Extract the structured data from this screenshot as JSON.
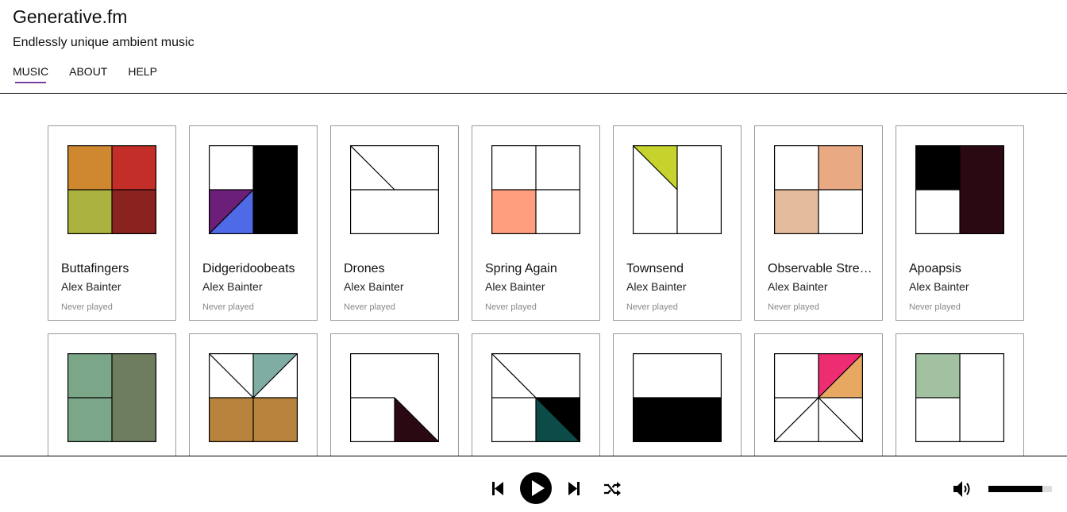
{
  "site": {
    "title": "Generative.fm",
    "tagline": "Endlessly unique ambient music"
  },
  "nav": [
    {
      "label": "MUSIC",
      "active": true
    },
    {
      "label": "ABOUT",
      "active": false
    },
    {
      "label": "HELP",
      "active": false
    }
  ],
  "pieces": [
    {
      "title": "Buttafingers",
      "artist": "Alex Bainter",
      "status": "Never played",
      "colors": [
        "#d08830",
        "#c42e28",
        "#abb23f",
        "#8a2220"
      ]
    },
    {
      "title": "Didgeridoobeats",
      "artist": "Alex Bainter",
      "status": "Never played",
      "colors": [
        "#6b1f78",
        "#4f6ae6",
        "#000000"
      ]
    },
    {
      "title": "Drones",
      "artist": "Alex Bainter",
      "status": "Never played",
      "colors": []
    },
    {
      "title": "Spring Again",
      "artist": "Alex Bainter",
      "status": "Never played",
      "colors": [
        "#ff9e7e"
      ]
    },
    {
      "title": "Townsend",
      "artist": "Alex Bainter",
      "status": "Never played",
      "colors": [
        "#c6d32c"
      ]
    },
    {
      "title": "Observable Stre…",
      "artist": "Alex Bainter",
      "status": "Never played",
      "colors": [
        "#e8a983",
        "#e3bb9b"
      ]
    },
    {
      "title": "Apoapsis",
      "artist": "Alex Bainter",
      "status": "Never played",
      "colors": [
        "#000000",
        "#2b0913"
      ]
    },
    {
      "colors": [
        "#7ba688",
        "#6f7d5f"
      ]
    },
    {
      "colors": [
        "#7fada3",
        "#b8833c"
      ]
    },
    {
      "colors": [
        "#2b0913"
      ]
    },
    {
      "colors": [
        "#0c4b47",
        "#000000"
      ]
    },
    {
      "colors": [
        "#000000"
      ]
    },
    {
      "colors": [
        "#ee2c72",
        "#e7a862"
      ]
    },
    {
      "colors": [
        "#a1c1a0"
      ]
    }
  ],
  "player": {
    "controls": [
      "previous-icon",
      "play-icon",
      "next-icon",
      "shuffle-icon",
      "volume-icon"
    ],
    "volume": 0.85
  }
}
